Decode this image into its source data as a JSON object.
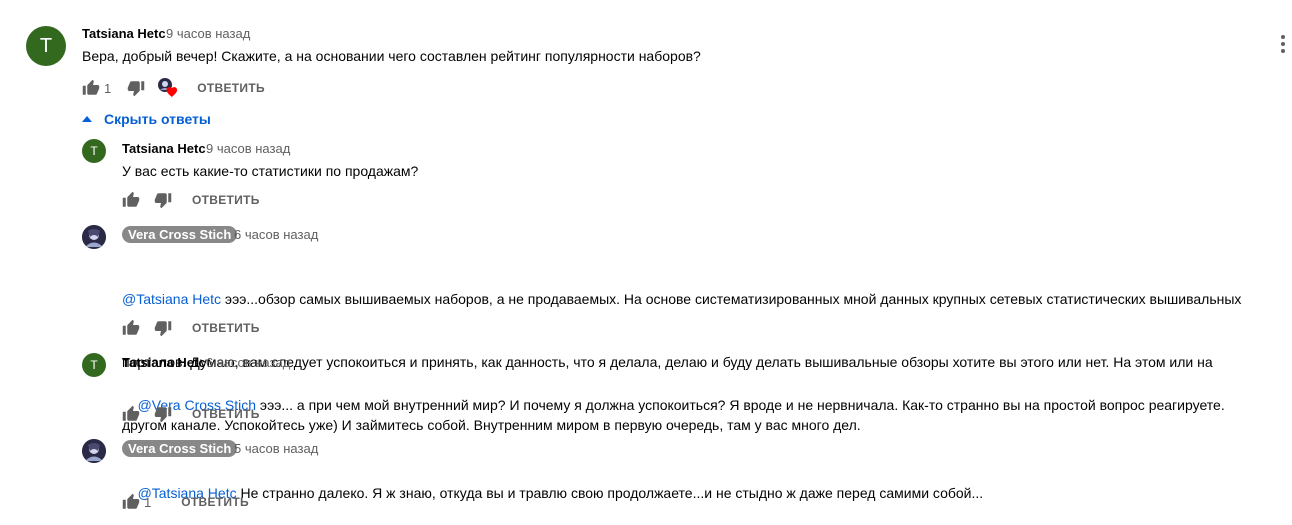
{
  "comments": [
    {
      "author": "Tatsiana Hetc",
      "time": "9 часов назад",
      "avatar_letter": "T",
      "text": "Вера, добрый вечер! Скажите, а на основании чего составлен рейтинг популярности наборов?",
      "likes": "1",
      "reply_label": "ОТВЕТИТЬ"
    }
  ],
  "hide_replies_label": "Скрыть ответы",
  "replies": [
    {
      "author": "Tatsiana Hetc",
      "time": "9 часов назад",
      "avatar_letter": "T",
      "mention": "",
      "text": "У вас есть какие-то статистики по продажам?",
      "reply_label": "ОТВЕТИТЬ"
    },
    {
      "author": "Vera Cross Stich",
      "time": "6 часов назад",
      "mention": "@Tatsiana Hetc",
      "text_line1": " эээ...обзор самых вышиваемых наборов, а не продаваемых. На основе систематизированных мной данных крупных сетевых статистических вышивальных",
      "text_line2": "порталов. Думаю, вам следует успокоиться и принять, как данность, что я делала, делаю и буду делать вышивальные обзоры хотите вы этого или нет. На этом или на",
      "text_line3": "другом канале. Успокойтесь уже) И займитесь собой. Внутренним миром в первую очередь, там у вас много дел.",
      "reply_label": "ОТВЕТИТЬ"
    },
    {
      "author": "Tatsiana Hetc",
      "time": "6 часов назад",
      "avatar_letter": "T",
      "mention": "@Vera Cross Stich",
      "text": " эээ... а при чем мой внутренний мир? И почему я должна успокоиться? Я вроде и не нервничала. Как-то странно вы на простой вопрос реагируете.",
      "reply_label": "ОТВЕТИТЬ"
    },
    {
      "author": "Vera Cross Stich",
      "time": "5 часов назад",
      "mention": "@Tatsiana Hetc",
      "text": " Не странно далеко. Я ж знаю, откуда вы и травлю свою продолжаете...и не стыдно ж даже перед самими собой...",
      "likes": "1",
      "reply_label": "ОТВЕТИТЬ"
    }
  ],
  "colors": {
    "avatar_green": "#33691e",
    "link_blue": "#065fd4",
    "chip_gray": "#888888",
    "heart_red": "#ff0000"
  },
  "icons": [
    "thumbs-up-icon",
    "thumbs-down-icon",
    "creator-heart-icon",
    "more-vert-icon",
    "caret-up-icon"
  ]
}
